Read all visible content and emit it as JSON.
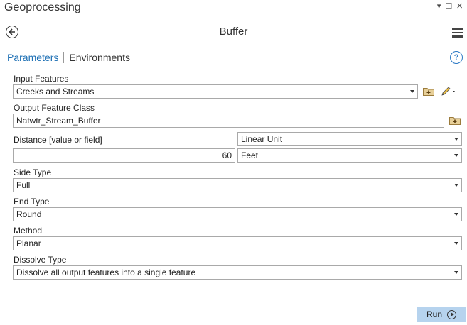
{
  "pane": {
    "title": "Geoprocessing",
    "controls": [
      "▾",
      "☐",
      "×"
    ]
  },
  "tool": {
    "title": "Buffer"
  },
  "tabs": {
    "parameters": "Parameters",
    "environments": "Environments",
    "help_glyph": "?"
  },
  "params": {
    "input_features": {
      "label": "Input Features",
      "value": "Creeks and Streams"
    },
    "output_feature_class": {
      "label": "Output Feature Class",
      "value": "Natwtr_Stream_Buffer"
    },
    "distance": {
      "label": "Distance [value or field]",
      "mode": "Linear Unit",
      "value": "60",
      "unit": "Feet"
    },
    "side_type": {
      "label": "Side Type",
      "value": "Full"
    },
    "end_type": {
      "label": "End Type",
      "value": "Round"
    },
    "method": {
      "label": "Method",
      "value": "Planar"
    },
    "dissolve_type": {
      "label": "Dissolve Type",
      "value": "Dissolve all output features into a single feature"
    }
  },
  "footer": {
    "run_label": "Run"
  },
  "colors": {
    "accent": "#1c6fb4",
    "run_button_bg": "#b6d3ee",
    "border": "#a9a9a9"
  }
}
